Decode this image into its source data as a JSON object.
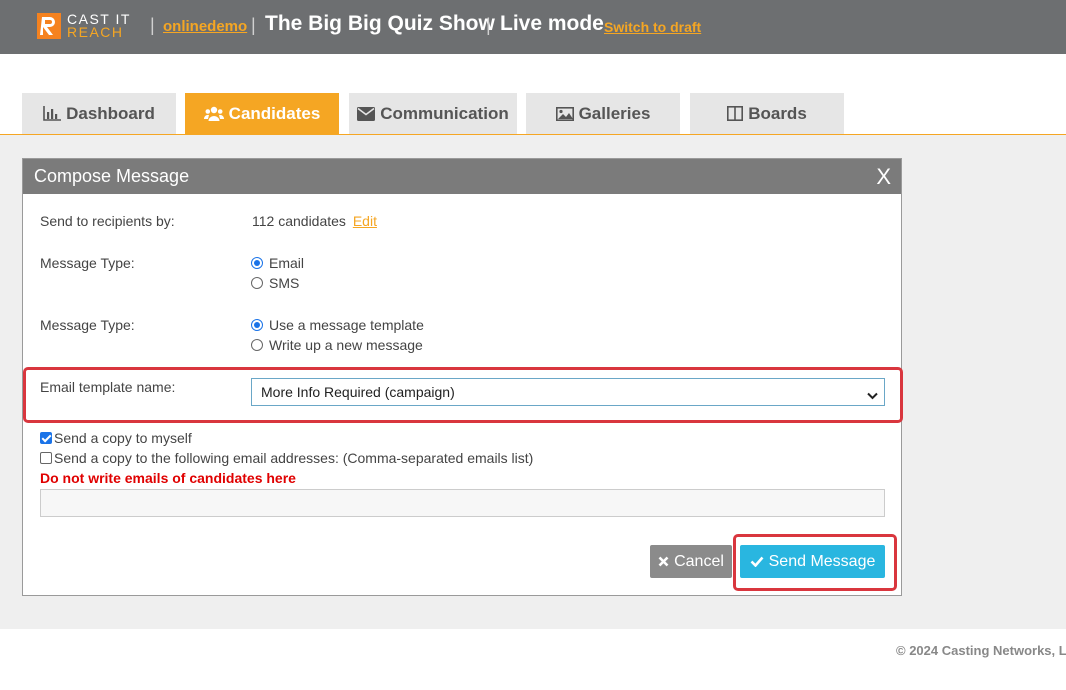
{
  "header": {
    "logo_line1": "CAST IT",
    "logo_line2": "REACH",
    "separator": "|",
    "account": "onlinedemo",
    "project_title": "The Big Big Quiz Show",
    "mode": "Live mode",
    "switch_link": "Switch to draft",
    "colors": {
      "bar": "#6d6f71",
      "accent": "#f5a623"
    }
  },
  "tabs": [
    {
      "label": "Dashboard",
      "icon": "bar-chart-icon",
      "active": false
    },
    {
      "label": "Candidates",
      "icon": "users-icon",
      "active": true
    },
    {
      "label": "Communication",
      "icon": "envelope-icon",
      "active": false
    },
    {
      "label": "Galleries",
      "icon": "image-icon",
      "active": false
    },
    {
      "label": "Boards",
      "icon": "columns-icon",
      "active": false
    }
  ],
  "modal": {
    "title": "Compose Message",
    "close": "X",
    "recipients_label": "Send to recipients by:",
    "recipients_value": "112 candidates",
    "recipients_edit": "Edit",
    "message_type_label": "Message Type:",
    "channel_options": [
      {
        "label": "Email",
        "selected": true
      },
      {
        "label": "SMS",
        "selected": false
      }
    ],
    "message_type_label_2": "Message Type:",
    "source_options": [
      {
        "label": "Use a message template",
        "selected": true
      },
      {
        "label": "Write up a new message",
        "selected": false
      }
    ],
    "template_label": "Email template name:",
    "template_selected": "More Info Required (campaign)",
    "copy_myself": {
      "label": "Send a copy to myself",
      "checked": true
    },
    "copy_others": {
      "label": "Send a copy to the following email addresses: (Comma-separated emails list)",
      "checked": false
    },
    "warning": "Do not write emails of candidates here",
    "emails_value": "",
    "cancel_label": "Cancel",
    "send_label": "Send Message",
    "colors": {
      "header": "#7b7b7b",
      "send": "#29b6e0",
      "cancel": "#8b8b8b",
      "highlight": "#d9363e",
      "warning": "#e00000"
    }
  },
  "footer": {
    "copyright": "© 2024 Casting Networks, L"
  }
}
